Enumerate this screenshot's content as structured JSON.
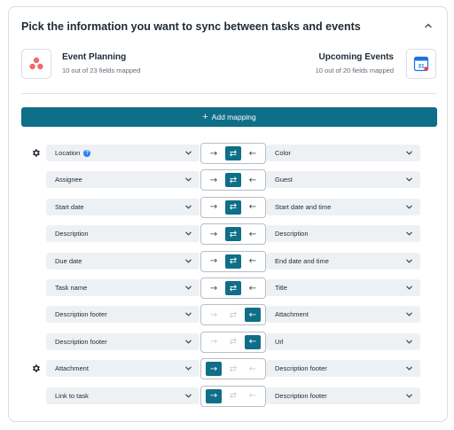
{
  "header": {
    "title": "Pick the information you want to sync between tasks and events"
  },
  "apps": {
    "left": {
      "name": "Event Planning",
      "mapped": "10 out of 23 fields mapped",
      "icon": "asana-icon"
    },
    "right": {
      "name": "Upcoming Events",
      "mapped": "10 out of 20 fields mapped",
      "icon": "calendar-icon",
      "calendar_day": "31"
    }
  },
  "add_mapping": {
    "icon": "+",
    "label": "Add mapping"
  },
  "colors": {
    "accent": "#0f6e88",
    "field_bg": "#eef1f4",
    "asana": "#f06a6a",
    "calendar_blue": "#1a73e8"
  },
  "direction_glyphs": {
    "right": "→",
    "both": "⇄",
    "left": "←"
  },
  "mappings": [
    {
      "left": "Location",
      "right": "Color",
      "direction": "both",
      "gear": true,
      "info": true
    },
    {
      "left": "Assignee",
      "right": "Guest",
      "direction": "both",
      "gear": false
    },
    {
      "left": "Start date",
      "right": "Start date and time",
      "direction": "both",
      "gear": false
    },
    {
      "left": "Description",
      "right": "Description",
      "direction": "both",
      "gear": false
    },
    {
      "left": "Due date",
      "right": "End date and time",
      "direction": "both",
      "gear": false
    },
    {
      "left": "Task name",
      "right": "Title",
      "direction": "both",
      "gear": false
    },
    {
      "left": "Description footer",
      "right": "Attachment",
      "direction": "left",
      "gear": false
    },
    {
      "left": "Description footer",
      "right": "Url",
      "direction": "left",
      "gear": false
    },
    {
      "left": "Attachment",
      "right": "Description footer",
      "direction": "right",
      "gear": true
    },
    {
      "left": "Link to task",
      "right": "Description footer",
      "direction": "right",
      "gear": false
    }
  ]
}
